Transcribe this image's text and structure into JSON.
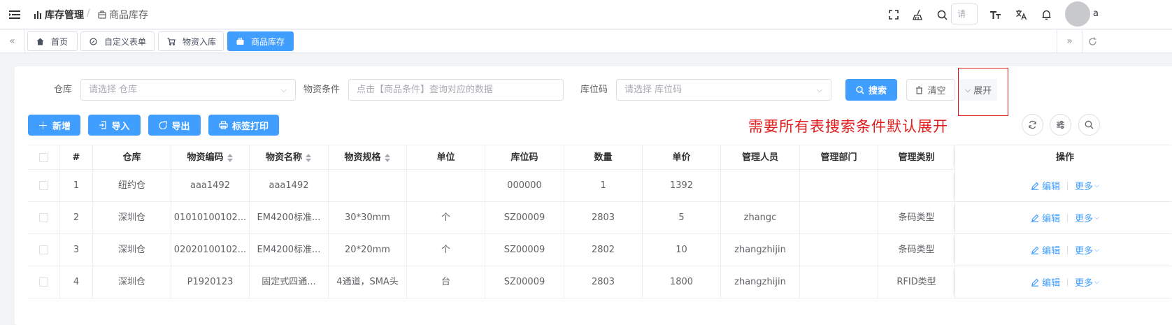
{
  "header": {
    "breadcrumb": [
      "库存管理",
      "商品库存"
    ],
    "breadcrumb_sep": "/",
    "search_placeholder": "请",
    "avatar_letter": "a",
    "icons": [
      "fullscreen-icon",
      "broom-icon",
      "search-icon",
      "font-size-icon",
      "translate-icon",
      "bell-icon"
    ]
  },
  "tabs": [
    {
      "label": "首页",
      "icon": "home-icon",
      "active": false
    },
    {
      "label": "自定义表单",
      "icon": "edit-icon",
      "active": false
    },
    {
      "label": "物资入库",
      "icon": "cart-icon",
      "active": false
    },
    {
      "label": "商品库存",
      "icon": "briefcase-icon",
      "active": true
    }
  ],
  "filters": {
    "warehouse": {
      "label": "仓库",
      "placeholder": "请选择 仓库"
    },
    "material": {
      "label": "物资条件",
      "placeholder": "点击【商品条件】查询对应的数据"
    },
    "location": {
      "label": "库位码",
      "placeholder": "请选择 库位码"
    },
    "search_label": "搜索",
    "clear_label": "清空",
    "expand_label": "展开"
  },
  "toolbar": {
    "add_label": "新增",
    "import_label": "导入",
    "export_label": "导出",
    "print_label": "标签打印"
  },
  "annotation": "需要所有表搜索条件默认展开",
  "table": {
    "headers": [
      "#",
      "仓库",
      "物资编码",
      "物资名称",
      "物资规格",
      "单位",
      "库位码",
      "数量",
      "单价",
      "管理人员",
      "管理部门",
      "管理类别",
      "操作"
    ],
    "rows": [
      [
        "1",
        "纽约仓",
        "aaa1492",
        "aaa1492",
        "",
        "",
        "000000",
        "1",
        "1392",
        "",
        "",
        ""
      ],
      [
        "2",
        "深圳仓",
        "01010100102...",
        "EM4200标准...",
        "30*30mm",
        "个",
        "SZ00009",
        "2803",
        "5",
        "zhangc",
        "",
        "条码类型"
      ],
      [
        "3",
        "深圳仓",
        "02020100102...",
        "EM4200标准...",
        "20*20mm",
        "个",
        "SZ00009",
        "2802",
        "10",
        "zhangzhijin",
        "",
        "条码类型"
      ],
      [
        "4",
        "深圳仓",
        "P1920123",
        "固定式四通...",
        "4通道，SMA头",
        "台",
        "SZ00009",
        "2803",
        "1800",
        "zhangzhijin",
        "",
        "RFID类型"
      ]
    ],
    "edit_label": "编辑",
    "more_label": "更多"
  }
}
